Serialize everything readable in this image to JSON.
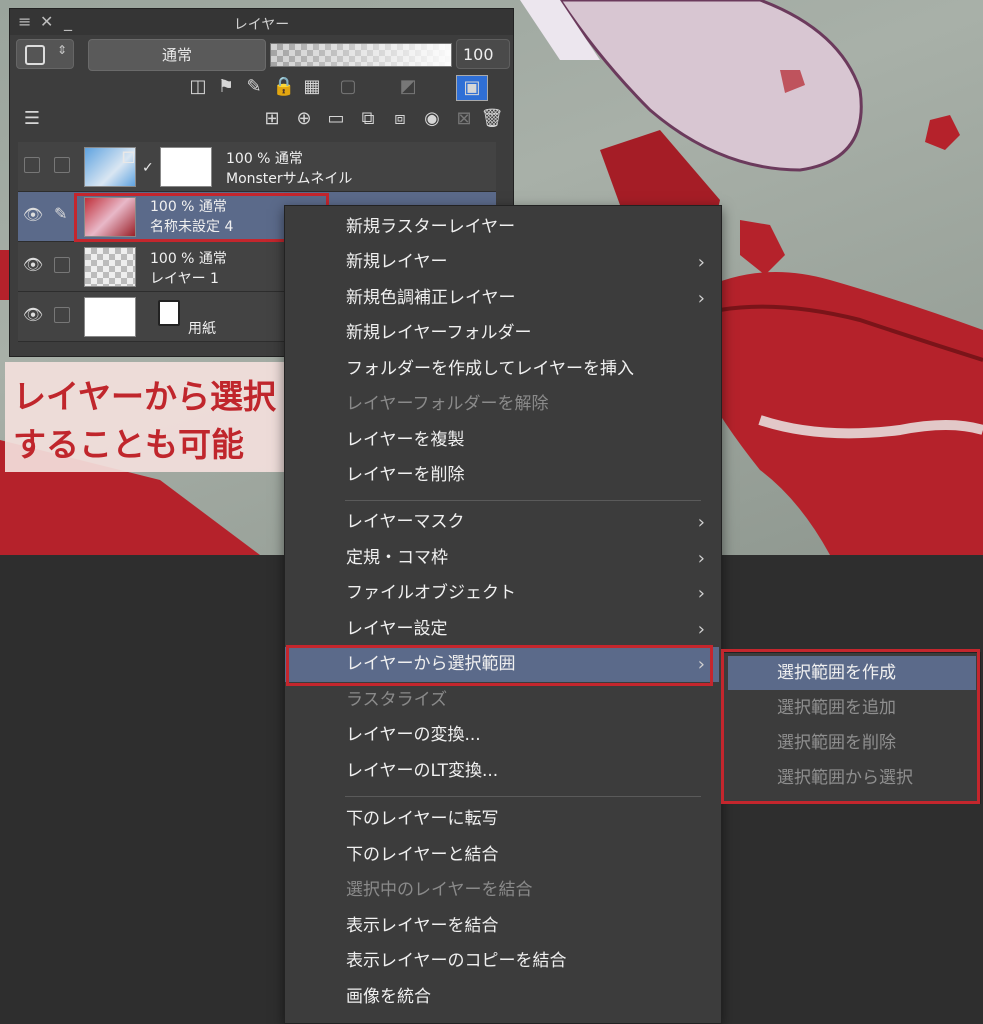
{
  "panel": {
    "title": "レイヤー",
    "blend_mode": "通常",
    "opacity_value": "100",
    "layers": [
      {
        "mode": "100 % 通常",
        "name": "Monsterサムネイル",
        "visible": false
      },
      {
        "mode": "100 % 通常",
        "name": "名称未設定 4",
        "visible": true,
        "selected": true
      },
      {
        "mode": "100 % 通常",
        "name": "レイヤー 1",
        "visible": true
      },
      {
        "mode": "",
        "name": "用紙",
        "visible": true
      }
    ]
  },
  "annotation": {
    "line1": "レイヤーから選択",
    "line2": "することも可能"
  },
  "menu": {
    "items": [
      {
        "label": "新規ラスターレイヤー"
      },
      {
        "label": "新規レイヤー",
        "submenu": true
      },
      {
        "label": "新規色調補正レイヤー",
        "submenu": true
      },
      {
        "label": "新規レイヤーフォルダー"
      },
      {
        "label": "フォルダーを作成してレイヤーを挿入"
      },
      {
        "label": "レイヤーフォルダーを解除",
        "disabled": true
      },
      {
        "label": "レイヤーを複製"
      },
      {
        "label": "レイヤーを削除"
      },
      {
        "label": "レイヤーマスク",
        "submenu": true
      },
      {
        "label": "定規・コマ枠",
        "submenu": true
      },
      {
        "label": "ファイルオブジェクト",
        "submenu": true
      },
      {
        "label": "レイヤー設定",
        "submenu": true
      },
      {
        "label": "レイヤーから選択範囲",
        "submenu": true,
        "highlighted": true
      },
      {
        "label": "ラスタライズ",
        "disabled": true
      },
      {
        "label": "レイヤーの変換..."
      },
      {
        "label": "レイヤーのLT変換..."
      },
      {
        "label": "下のレイヤーに転写"
      },
      {
        "label": "下のレイヤーと結合"
      },
      {
        "label": "選択中のレイヤーを結合",
        "disabled": true
      },
      {
        "label": "表示レイヤーを結合"
      },
      {
        "label": "表示レイヤーのコピーを結合"
      },
      {
        "label": "画像を統合"
      }
    ]
  },
  "submenu": {
    "items": [
      {
        "label": "選択範囲を作成",
        "highlighted": true
      },
      {
        "label": "選択範囲を追加"
      },
      {
        "label": "選択範囲を削除"
      },
      {
        "label": "選択範囲から選択"
      }
    ]
  },
  "colors": {
    "highlight": "#5b6a8a",
    "annotation_red": "#c4262d"
  }
}
